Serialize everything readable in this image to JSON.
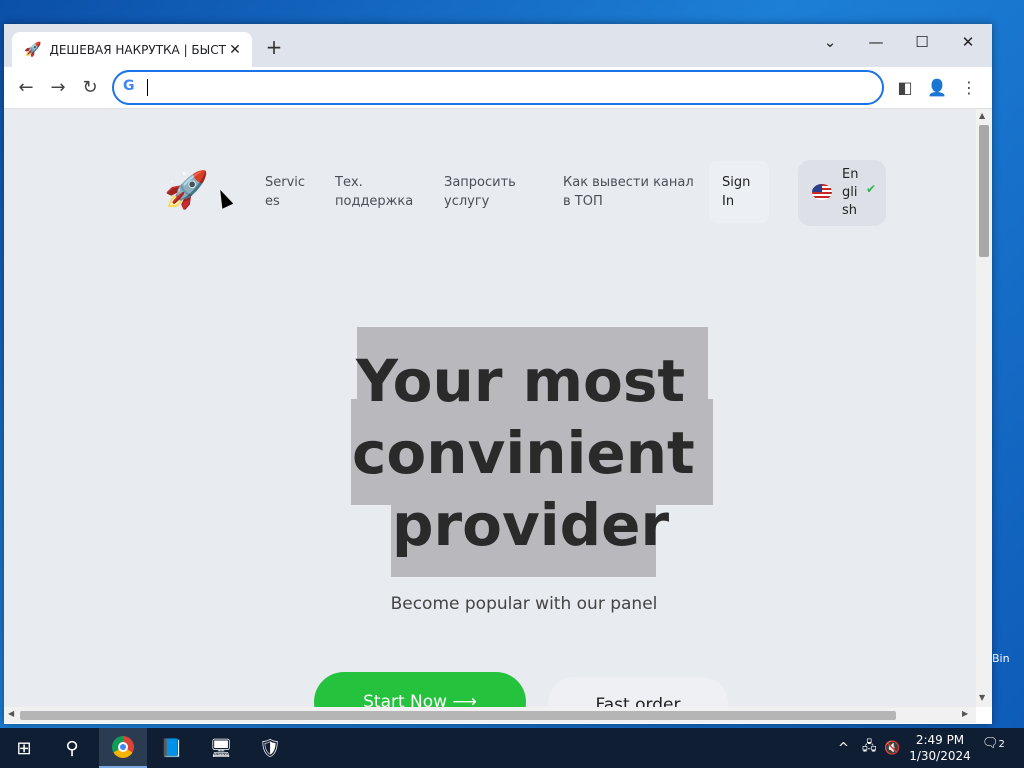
{
  "browser": {
    "tab_title": "ДЕШЕВАЯ НАКРУТКА | БЫСТРО",
    "tab_close": "✕",
    "new_tab": "+",
    "address_value": "",
    "google_g": "G"
  },
  "site": {
    "nav": {
      "links": [
        "Servic\nes",
        "Тех.\nподдержка",
        "Запросить\nуслугу",
        "Как вывести канал\nв ТОП"
      ],
      "sign_in": "Sign In",
      "language": "English"
    },
    "hero": {
      "line1": "Your most",
      "line2": "convinient",
      "line3": "provider",
      "subtitle": "Become popular with our panel",
      "start_button": "Start Now ⟶",
      "fast_order_button": "Fast order"
    }
  },
  "desktop": {
    "recycle_label": "Bin"
  },
  "taskbar": {
    "time": "2:49 PM",
    "date": "1/30/2024",
    "notification_count": "2"
  },
  "colors": {
    "accent": "#1a73e8",
    "start_button": "#24c23d",
    "page_bg": "#e8ebef",
    "highlight": "#b9b9bd",
    "taskbar": "#0f1e33"
  }
}
